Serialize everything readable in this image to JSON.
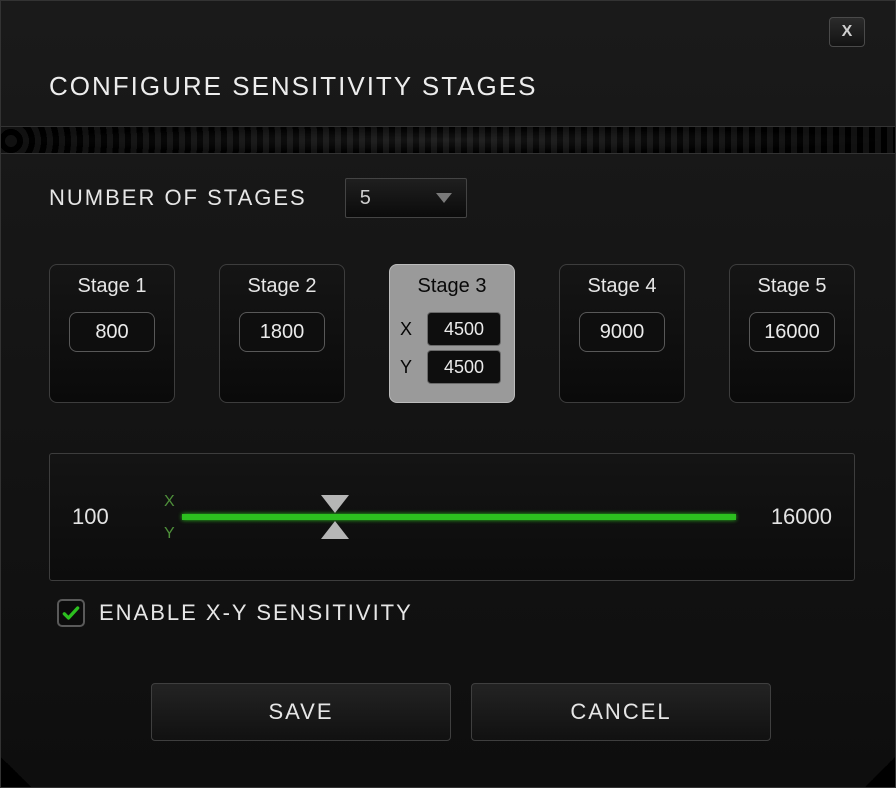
{
  "dialog": {
    "title": "CONFIGURE SENSITIVITY STAGES",
    "close_label": "X"
  },
  "stages_count": {
    "label": "NUMBER OF STAGES",
    "value": "5"
  },
  "stages": [
    {
      "name": "Stage 1",
      "value": "800",
      "selected": false
    },
    {
      "name": "Stage 2",
      "value": "1800",
      "selected": false
    },
    {
      "name": "Stage 3",
      "x": "4500",
      "y": "4500",
      "selected": true
    },
    {
      "name": "Stage 4",
      "value": "9000",
      "selected": false
    },
    {
      "name": "Stage 5",
      "value": "16000",
      "selected": false
    }
  ],
  "slider": {
    "min_label": "100",
    "max_label": "16000",
    "min": 100,
    "max": 16000,
    "x_axis_label": "X",
    "y_axis_label": "Y",
    "x_value": 4500,
    "y_value": 4500
  },
  "xy_checkbox": {
    "checked": true,
    "label": "ENABLE X-Y SENSITIVITY"
  },
  "buttons": {
    "save": "SAVE",
    "cancel": "CANCEL"
  },
  "colors": {
    "accent": "#2cbf1f"
  }
}
